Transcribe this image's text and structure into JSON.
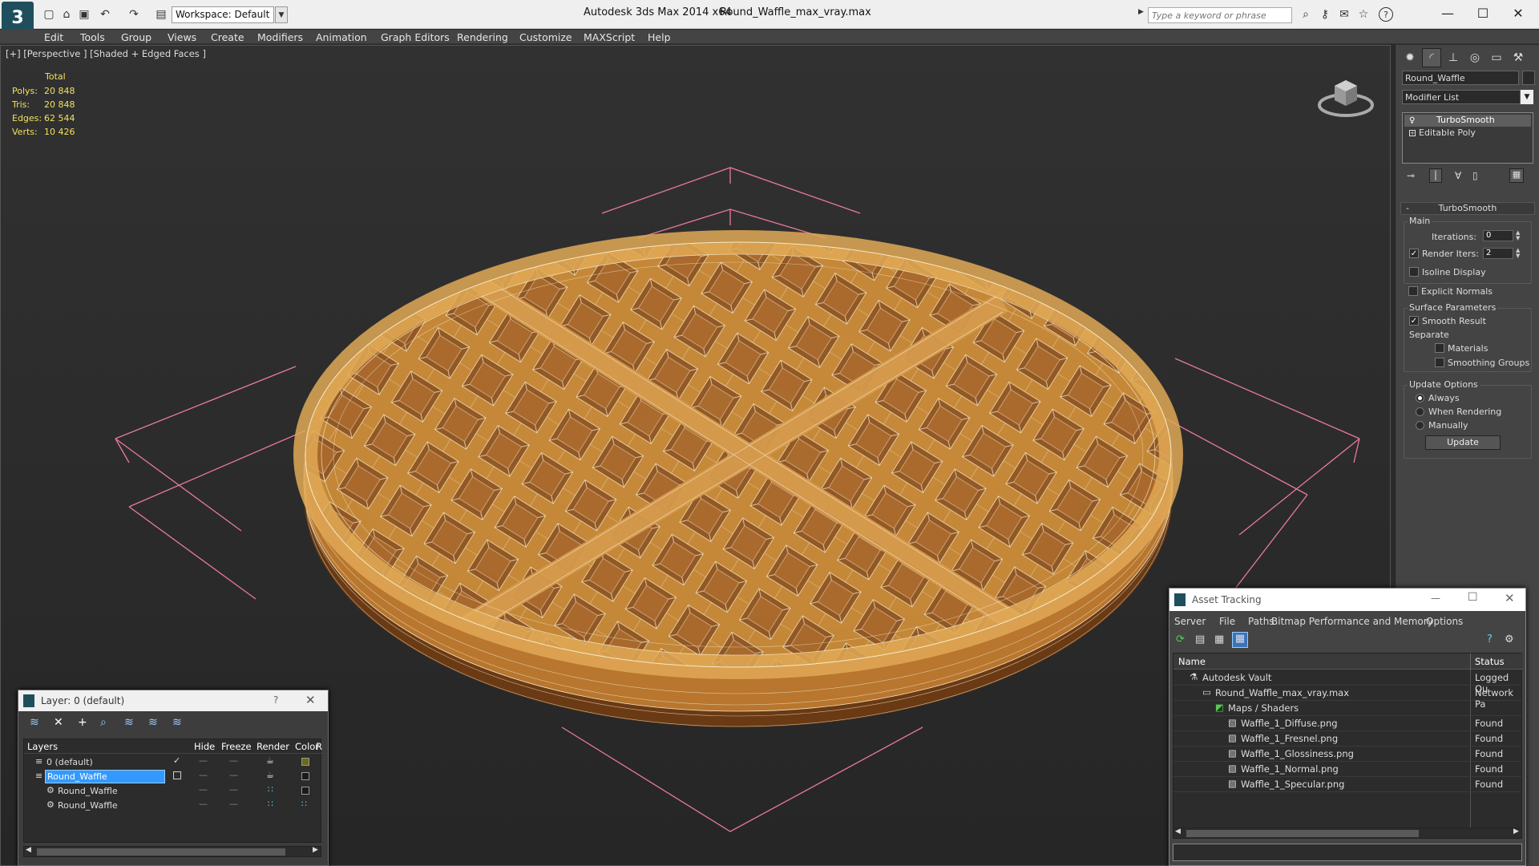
{
  "titlebar": {
    "logo_text": "3",
    "workspace": "Workspace: Default",
    "app_title": "Autodesk 3ds Max  2014 x64",
    "document": "Round_Waffle_max_vray.max",
    "search_placeholder": "Type a keyword or phrase"
  },
  "menu": [
    "Edit",
    "Tools",
    "Group",
    "Views",
    "Create",
    "Modifiers",
    "Animation",
    "Graph Editors",
    "Rendering",
    "Customize",
    "MAXScript",
    "Help"
  ],
  "viewport": {
    "label": "[+] [Perspective ] [Shaded + Edged Faces ]",
    "stats": {
      "header": "Total",
      "rows": [
        {
          "label": "Polys:",
          "value": "20 848"
        },
        {
          "label": "Tris:",
          "value": "20 848"
        },
        {
          "label": "Edges:",
          "value": "62 544"
        },
        {
          "label": "Verts:",
          "value": "10 426"
        }
      ]
    }
  },
  "command_panel": {
    "object_name": "Round_Waffle",
    "modifier_list": "Modifier List",
    "stack": [
      "TurboSmooth",
      "Editable Poly"
    ],
    "rollout_title": "TurboSmooth",
    "main_label": "Main",
    "iterations_label": "Iterations:",
    "iterations_value": "0",
    "render_iters_label": "Render Iters:",
    "render_iters_value": "2",
    "isoline": "Isoline Display",
    "explicit_normals": "Explicit Normals",
    "surface_params": "Surface Parameters",
    "smooth_result": "Smooth Result",
    "separate": "Separate",
    "materials": "Materials",
    "smoothing_groups": "Smoothing Groups",
    "update_options": "Update Options",
    "always": "Always",
    "when_rendering": "When Rendering",
    "manually": "Manually",
    "update_button": "Update"
  },
  "layers": {
    "title": "Layer: 0 (default)",
    "help": "?",
    "columns": [
      "Layers",
      "Hide",
      "Freeze",
      "Render",
      "Color",
      "R"
    ],
    "rows": [
      {
        "name": "0 (default)",
        "color": "#6b6b1a"
      },
      {
        "name": "Round_Waffle",
        "color": "#1a1a1a"
      },
      {
        "name": "Round_Waffle",
        "color": "#1a1a1a"
      },
      {
        "name": "Round_Waffle",
        "color": ""
      }
    ]
  },
  "asset_tracking": {
    "title": "Asset Tracking",
    "menu": [
      "Server",
      "File",
      "Paths",
      "Bitmap Performance and Memory",
      "Options"
    ],
    "columns": [
      "Name",
      "Status"
    ],
    "rows": [
      {
        "name": "Autodesk Vault",
        "status": "Logged Ou"
      },
      {
        "name": "Round_Waffle_max_vray.max",
        "status": "Network Pa"
      },
      {
        "name": "Maps / Shaders",
        "status": ""
      },
      {
        "name": "Waffle_1_Diffuse.png",
        "status": "Found"
      },
      {
        "name": "Waffle_1_Fresnel.png",
        "status": "Found"
      },
      {
        "name": "Waffle_1_Glossiness.png",
        "status": "Found"
      },
      {
        "name": "Waffle_1_Normal.png",
        "status": "Found"
      },
      {
        "name": "Waffle_1_Specular.png",
        "status": "Found"
      }
    ]
  },
  "colors": {
    "waffle": "#c98a3c",
    "waffle_dark": "#8a5420",
    "wire": "#f5e9c8",
    "gizmo": "#e87a9a",
    "selection": "#3399ff"
  }
}
